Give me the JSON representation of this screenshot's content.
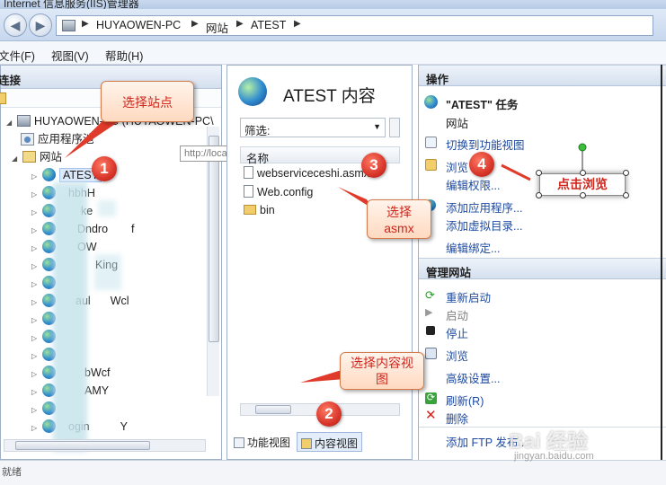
{
  "window": {
    "title": "Internet 信息服务(IIS)管理器"
  },
  "address": {
    "back_icon": "back-arrow-icon",
    "forward_icon": "forward-arrow-icon",
    "path": [
      "HUYAOWEN-PC",
      "网站",
      "ATEST"
    ]
  },
  "menu": {
    "file": "文件(F)",
    "view": "视图(V)",
    "help": "帮助(H)"
  },
  "left_pane": {
    "header": "连接",
    "tree": {
      "server": "HUYAOWEN-PC (HUYAOWEN-PC\\",
      "app_pools": "应用程序池",
      "sites": "网站",
      "selected_site": "ATEST",
      "visible_fragments": [
        "hbhH",
        "ke",
        "Dndro",
        "f",
        "OW",
        "King",
        "aul",
        "Wcl",
        "bWcf",
        "AMY",
        "ogin",
        "Y"
      ]
    },
    "tooltip": "http://localhost"
  },
  "middle_pane": {
    "title": "ATEST 内容",
    "filter_label": "筛选:",
    "column_name": "名称",
    "files": [
      {
        "name": "webserviceceshi.asmx",
        "icon": "asmx-file-icon"
      },
      {
        "name": "Web.config",
        "icon": "config-file-icon"
      },
      {
        "name": "bin",
        "icon": "folder-icon"
      }
    ],
    "tabs": {
      "features": "功能视图",
      "content": "内容视图"
    }
  },
  "right_pane": {
    "header": "操作",
    "site_title": "\"ATEST\" 任务",
    "site_subtitle": "网站",
    "actions_top": [
      "切换到功能视图",
      "浏览",
      "编辑权限...",
      "添加应用程序...",
      "添加虚拟目录...",
      "编辑绑定..."
    ],
    "manage_header": "管理网站",
    "restart": "重新启动",
    "start": "启动",
    "stop": "停止",
    "browse2": "浏览",
    "advanced": "高级设置...",
    "refresh": "刷新(R)",
    "delete": "删除",
    "add_ftp": "添加 FTP 发布..."
  },
  "annotations": {
    "select_site": "选择站点",
    "select_asmx": "选择\nasmx",
    "select_content_view": "选择内容视\n图",
    "click_browse": "点击浏览",
    "badges": [
      "1",
      "2",
      "3",
      "4"
    ]
  },
  "statusbar": {
    "text": "就绪"
  },
  "watermark": {
    "line1": "Bai 经验",
    "line2": "jingyan.baidu.com"
  },
  "colors": {
    "accent": "#1d4aa0",
    "callout_text": "#d0261c",
    "badge": "#d8362a"
  }
}
